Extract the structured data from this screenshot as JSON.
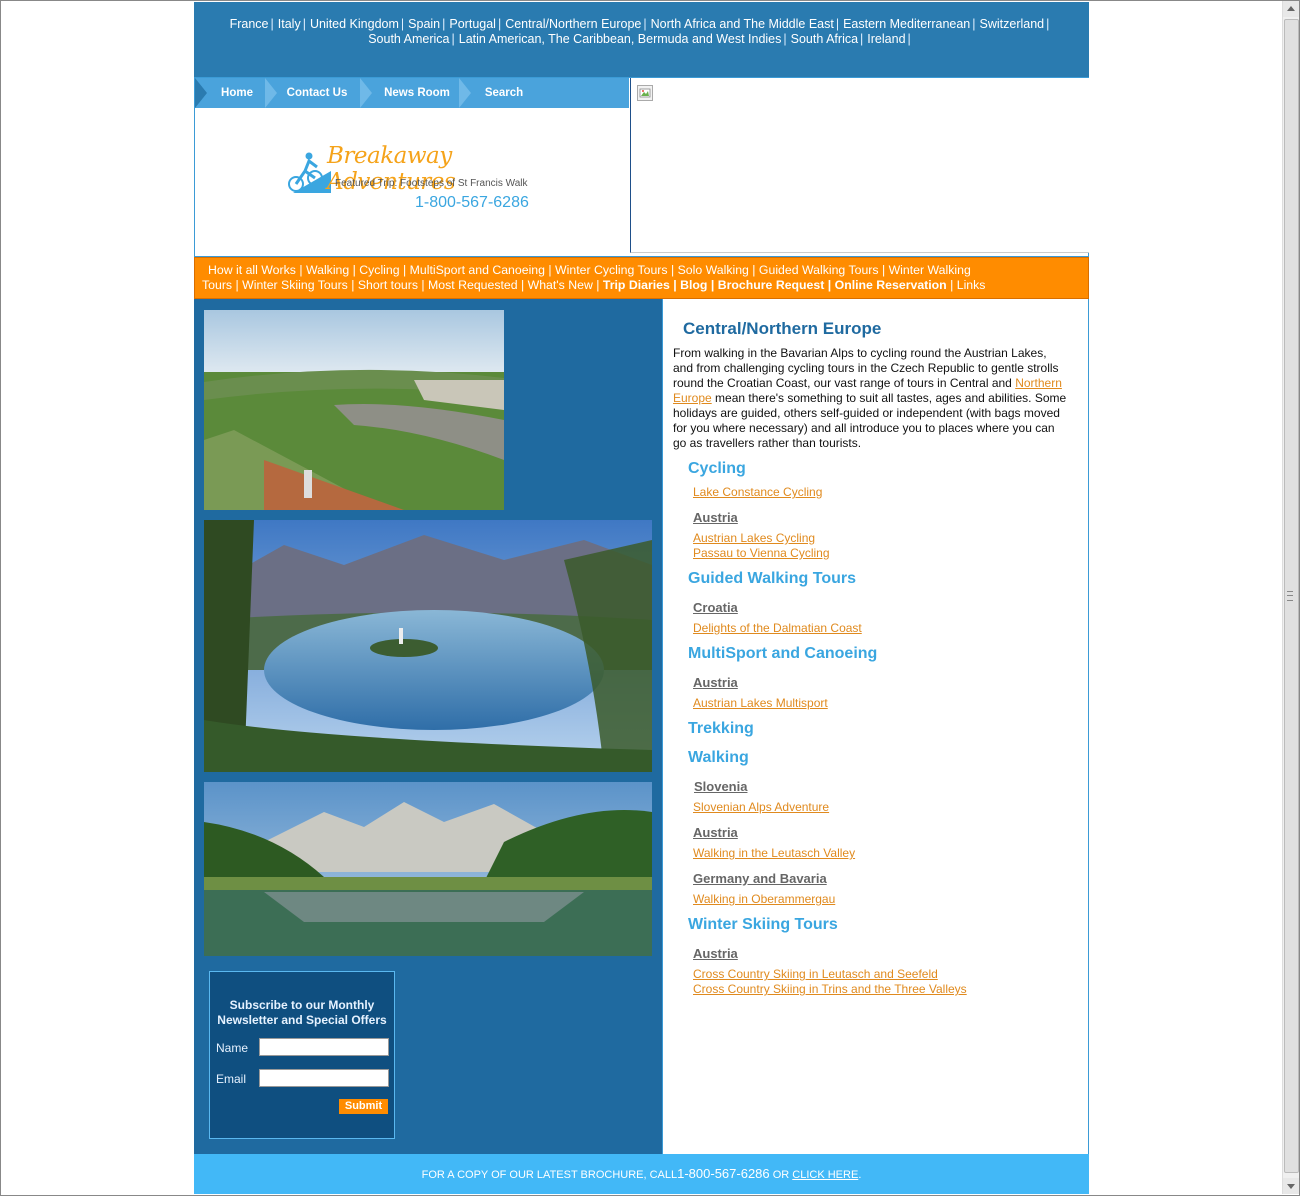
{
  "top_nav": {
    "row1": [
      "France",
      "Italy",
      "United Kingdom",
      "Spain",
      "Portugal",
      "Central/Northern Europe",
      "North Africa and The Middle East",
      "Eastern Mediterranean",
      "Switzerland"
    ],
    "row2": [
      "South America",
      "Latin American, The Caribbean, Bermuda and West Indies",
      "South Africa",
      "Ireland"
    ],
    "separator": "|"
  },
  "main_nav": {
    "home": "Home",
    "contact": "Contact Us",
    "news": "News Room",
    "search": "Search"
  },
  "logo": {
    "brand": "Breakaway Adventures",
    "featured": "Featured Trip: Footsteps of St Francis Walk",
    "phone": "1-800-567-6286"
  },
  "orange_nav": {
    "line1": [
      "How it all Works",
      "Walking",
      "Cycling",
      "MultiSport and Canoeing",
      "Winter Cycling Tours",
      "Solo Walking",
      "Guided Walking Tours",
      "Winter Walking"
    ],
    "line2_plain": [
      "Tours",
      "Winter Skiing Tours",
      "Short tours",
      "Most Requested",
      "What's New"
    ],
    "line2_bold": [
      "Trip Diaries",
      "Blog",
      "Brochure Request",
      "Online Reservation"
    ],
    "links": "Links"
  },
  "content": {
    "title": "Central/Northern Europe",
    "intro_before": "From walking in the Bavarian Alps to cycling round the Austrian Lakes, and from challenging cycling tours in the Czech Republic to gentle strolls round the Croatian Coast, our vast range of tours in Central and ",
    "intro_link": "Northern Europe",
    "intro_after": " mean there's something to suit all tastes, ages and abilities. Some holidays are guided, others self-guided or independent (with bags moved for you where necessary) and all introduce you to places where you can go as travellers rather than tourists.",
    "sections": {
      "cycling": "Cycling",
      "cycling_link1": "Lake Constance Cycling",
      "cycling_country": "Austria",
      "cycling_link2": "Austrian Lakes Cycling",
      "cycling_link3": "Passau to Vienna Cycling",
      "guided": "Guided Walking Tours",
      "guided_country": "Croatia",
      "guided_link": "Delights of the Dalmatian Coast",
      "multisport": "MultiSport and Canoeing",
      "multisport_country": "Austria",
      "multisport_link": "Austrian Lakes Multisport",
      "trekking": "Trekking",
      "walking": "Walking",
      "walking_country1": "Slovenia",
      "walking_link1": "Slovenian Alps Adventure",
      "walking_country2": "Austria",
      "walking_link2": "Walking in the Leutasch Valley",
      "walking_country3": "Germany and Bavaria",
      "walking_link3": "Walking in Oberammergau",
      "skiing": "Winter Skiing Tours",
      "skiing_country": "Austria",
      "skiing_link1": "Cross Country Skiing in Leutasch and Seefeld",
      "skiing_link2": "Cross Country Skiing in Trins and the Three Valleys"
    }
  },
  "newsletter": {
    "title": "Subscribe to our Monthly Newsletter and Special Offers",
    "name_label": "Name",
    "email_label": "Email",
    "name_value": "",
    "email_value": "",
    "submit": "Submit"
  },
  "footer": {
    "text": "FOR A COPY OF OUR LATEST BROCHURE, CALL",
    "phone": "1-800-567-6286",
    "or": " OR ",
    "click": "CLICK HERE",
    "end": "."
  },
  "colors": {
    "blue": "#2a7bb0",
    "orange": "#ff8c00",
    "light_blue": "#42b8f7",
    "link_orange": "#e08a1e",
    "section_blue": "#3aa6e0"
  }
}
